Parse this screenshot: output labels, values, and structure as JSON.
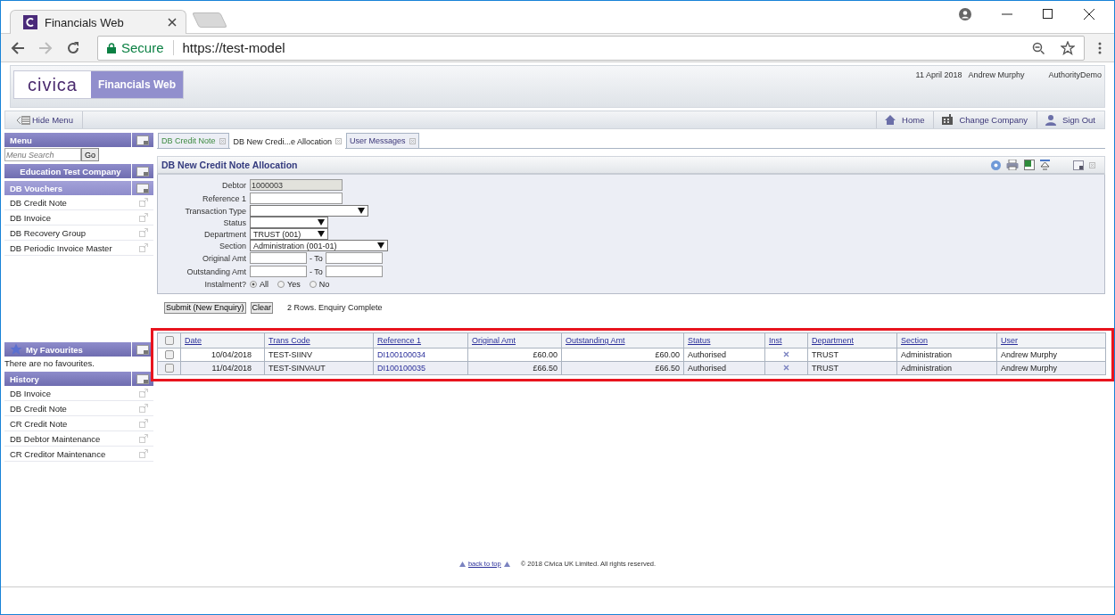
{
  "browser": {
    "tab_title": "Financials Web",
    "secure_label": "Secure",
    "url": "https://test-model"
  },
  "header": {
    "logo": "civica",
    "product": "Financials Web",
    "date": "11 April 2018",
    "user": "Andrew Murphy",
    "authority": "AuthorityDemo"
  },
  "toolbar": {
    "hide_menu": "Hide Menu",
    "links": [
      {
        "kind": "home",
        "label": "Home"
      },
      {
        "kind": "company",
        "label": "Change Company"
      },
      {
        "kind": "signout",
        "label": "Sign Out"
      }
    ]
  },
  "sidebar": {
    "menu_title": "Menu",
    "search_placeholder": "Menu Search",
    "go": "Go",
    "company": "Education Test Company",
    "group_title": "DB Vouchers",
    "items": [
      "DB Credit Note",
      "DB Invoice",
      "DB Recovery Group",
      "DB Periodic Invoice Master"
    ],
    "favourites_title": "My Favourites",
    "favourites_empty": "There are no favourites.",
    "history_title": "History",
    "history_items": [
      "DB Invoice",
      "DB Credit Note",
      "CR Credit Note",
      "DB Debtor Maintenance",
      "CR Creditor Maintenance"
    ]
  },
  "tabs": [
    {
      "label": "DB Credit Note",
      "selected": false
    },
    {
      "label": "DB New Credi...e Allocation",
      "selected": true
    },
    {
      "label": "User Messages",
      "selected": false
    }
  ],
  "form": {
    "title": "DB New Credit Note Allocation",
    "fields": [
      {
        "kind": "text",
        "label": "Debtor",
        "value": "1000003",
        "disabled": true
      },
      {
        "kind": "text",
        "label": "Reference 1",
        "disabled": false
      },
      {
        "kind": "select",
        "label": "Transaction Type"
      },
      {
        "kind": "select",
        "label": "Status"
      },
      {
        "kind": "select",
        "label": "Department",
        "value": "TRUST (001)"
      },
      {
        "kind": "select",
        "label": "Section",
        "value": "Administration (001-01)"
      },
      {
        "kind": "range",
        "label": "Original Amt",
        "separator": "- To"
      },
      {
        "kind": "range",
        "label": "Outstanding Amt",
        "separator": "- To"
      },
      {
        "kind": "radio",
        "label": "Instalment?",
        "options": [
          {
            "label": "All",
            "selected": true
          },
          {
            "label": "Yes",
            "selected": false
          },
          {
            "label": "No",
            "selected": false
          }
        ]
      }
    ],
    "buttons": [
      "Submit (New Enquiry)",
      "Clear"
    ],
    "result_message": "2 Rows. Enquiry Complete"
  },
  "results": {
    "highlighted": true,
    "select_all_checked": false,
    "columns": [
      "Date",
      "Trans Code",
      "Reference 1",
      "Original Amt",
      "Outstanding Amt",
      "Status",
      "Inst",
      "Department",
      "Section",
      "User"
    ],
    "rows": [
      {
        "checked": false,
        "date": "10/04/2018",
        "trans_code": "TEST-SIINV",
        "reference": "DI100100034",
        "original_amt": "£60.00",
        "outstanding_amt": "£60.00",
        "status": "Authorised",
        "instalment": false,
        "department": "TRUST",
        "section": "Administration",
        "user": "Andrew Murphy"
      },
      {
        "checked": false,
        "date": "11/04/2018",
        "trans_code": "TEST-SINVAUT",
        "reference": "DI100100035",
        "original_amt": "£66.50",
        "outstanding_amt": "£66.50",
        "status": "Authorised",
        "instalment": false,
        "department": "TRUST",
        "section": "Administration",
        "user": "Andrew Murphy"
      }
    ]
  },
  "footer": {
    "back_to_top": "back to top",
    "copyright": "© 2018 Civica UK Limited. All rights reserved."
  }
}
